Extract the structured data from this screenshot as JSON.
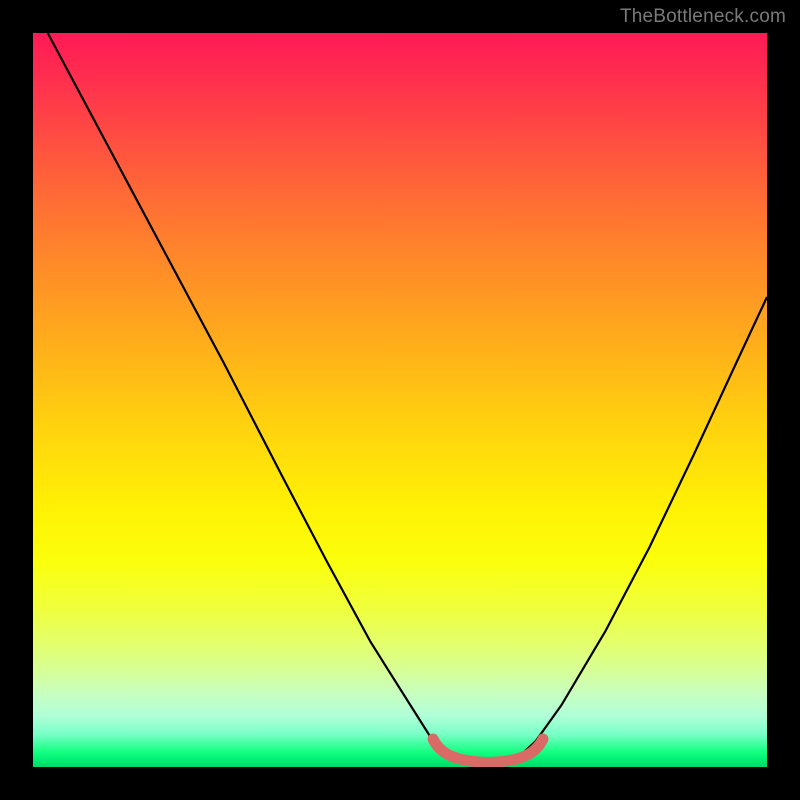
{
  "watermark": "TheBottleneck.com",
  "chart_data": {
    "type": "line",
    "title": "",
    "xlabel": "",
    "ylabel": "",
    "xlim": [
      0,
      1
    ],
    "ylim": [
      0,
      1
    ],
    "series": [
      {
        "name": "main-curve",
        "x": [
          0.02,
          0.1,
          0.18,
          0.26,
          0.34,
          0.4,
          0.46,
          0.52,
          0.545,
          0.58,
          0.62,
          0.66,
          0.685,
          0.72,
          0.78,
          0.84,
          0.9,
          0.96,
          1.0
        ],
        "values": [
          1.0,
          0.85,
          0.7,
          0.55,
          0.395,
          0.28,
          0.17,
          0.075,
          0.035,
          0.012,
          0.006,
          0.012,
          0.035,
          0.085,
          0.185,
          0.3,
          0.425,
          0.555,
          0.64
        ]
      },
      {
        "name": "bottom-marker",
        "x": [
          0.545,
          0.57,
          0.6,
          0.63,
          0.66,
          0.685
        ],
        "values": [
          0.038,
          0.02,
          0.012,
          0.012,
          0.02,
          0.038
        ]
      }
    ],
    "marker_color": "#d96a65",
    "line_color": "#000000"
  }
}
